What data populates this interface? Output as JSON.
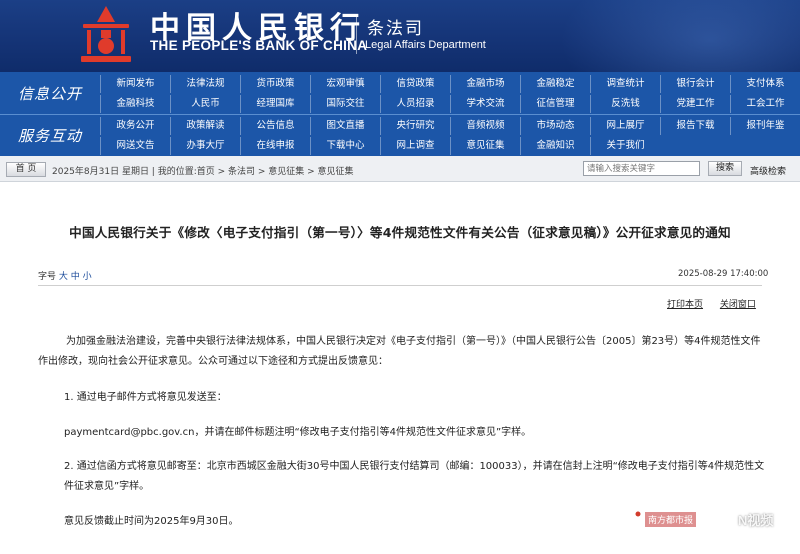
{
  "header": {
    "bank_name_cn": "中国人民银行",
    "bank_name_en": "THE PEOPLE'S BANK OF CHINA",
    "dept_cn": "条法司",
    "dept_en": "Legal Affairs Department"
  },
  "nav": {
    "group1_label": "信息公开",
    "group2_label": "服务互动",
    "rows": [
      [
        "新闻发布",
        "法律法规",
        "货币政策",
        "宏观审慎",
        "信贷政策",
        "金融市场",
        "金融稳定",
        "调查统计",
        "银行会计",
        "支付体系"
      ],
      [
        "金融科技",
        "人民币",
        "经理国库",
        "国际交往",
        "人员招录",
        "学术交流",
        "征信管理",
        "反洗钱",
        "党建工作",
        "工会工作"
      ],
      [
        "政务公开",
        "政策解读",
        "公告信息",
        "图文直播",
        "央行研究",
        "音频视频",
        "市场动态",
        "网上展厅",
        "报告下载",
        "报刊年鉴"
      ],
      [
        "网送文告",
        "办事大厅",
        "在线申报",
        "下载中心",
        "网上调查",
        "意见征集",
        "金融知识",
        "关于我们",
        "",
        ""
      ]
    ]
  },
  "breadcrumb": {
    "home_button": "首 页",
    "text": "2025年8月31日 星期日 | 我的位置:首页 > 条法司 > 意见征集 > 意见征集",
    "search_placeholder": "请输入搜索关键字",
    "search_button": "搜索",
    "advanced_search": "高级检索"
  },
  "article": {
    "title": "中国人民银行关于《修改〈电子支付指引（第一号）〉等4件规范性文件有关公告（征求意见稿）》公开征求意见的通知",
    "font_size_prefix": "字号",
    "font_large": "大",
    "font_medium": "中",
    "font_small": "小",
    "datetime": "2025-08-29 17:40:00",
    "print_label": "打印本页",
    "close_label": "关闭窗口",
    "paragraphs": [
      "为加强金融法治建设，完善中央银行法律法规体系，中国人民银行决定对《电子支付指引（第一号）》（中国人民银行公告〔2005〕第23号）等4件规范性文件作出修改，现向社会公开征求意见。公众可通过以下途径和方式提出反馈意见：",
      "1. 通过电子邮件方式将意见发送至：",
      "paymentcard@pbc.gov.cn，并请在邮件标题注明“修改电子支付指引等4件规范性文件征求意见”字样。",
      "2. 通过信函方式将意见邮寄至：北京市西城区金融大街30号中国人民银行支付结算司（邮编：100033），并请在信封上注明“修改电子支付指引等4件规范性文件征求意见”字样。",
      "意见反馈截止时间为2025年9月30日。"
    ]
  },
  "watermarks": {
    "nc_label": "南方都市报",
    "nv_text": "N视频"
  },
  "colors": {
    "banner": "#153477",
    "nav": "#1c56a8",
    "logo": "#e03b2b"
  }
}
